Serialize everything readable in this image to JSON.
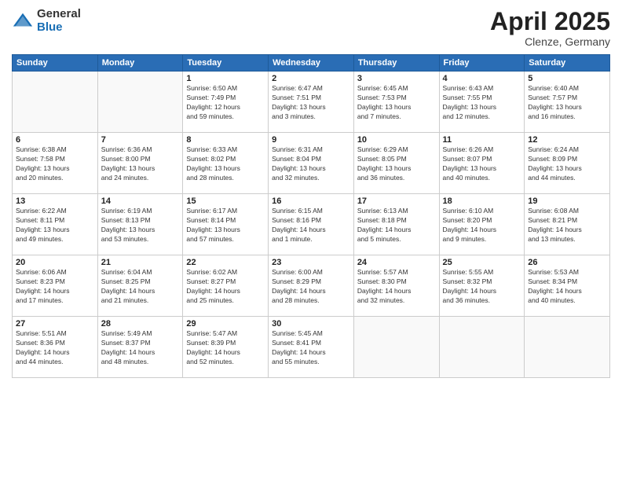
{
  "logo": {
    "general": "General",
    "blue": "Blue"
  },
  "title": {
    "month_year": "April 2025",
    "location": "Clenze, Germany"
  },
  "weekdays": [
    "Sunday",
    "Monday",
    "Tuesday",
    "Wednesday",
    "Thursday",
    "Friday",
    "Saturday"
  ],
  "weeks": [
    [
      {
        "day": "",
        "info": ""
      },
      {
        "day": "",
        "info": ""
      },
      {
        "day": "1",
        "info": "Sunrise: 6:50 AM\nSunset: 7:49 PM\nDaylight: 12 hours\nand 59 minutes."
      },
      {
        "day": "2",
        "info": "Sunrise: 6:47 AM\nSunset: 7:51 PM\nDaylight: 13 hours\nand 3 minutes."
      },
      {
        "day": "3",
        "info": "Sunrise: 6:45 AM\nSunset: 7:53 PM\nDaylight: 13 hours\nand 7 minutes."
      },
      {
        "day": "4",
        "info": "Sunrise: 6:43 AM\nSunset: 7:55 PM\nDaylight: 13 hours\nand 12 minutes."
      },
      {
        "day": "5",
        "info": "Sunrise: 6:40 AM\nSunset: 7:57 PM\nDaylight: 13 hours\nand 16 minutes."
      }
    ],
    [
      {
        "day": "6",
        "info": "Sunrise: 6:38 AM\nSunset: 7:58 PM\nDaylight: 13 hours\nand 20 minutes."
      },
      {
        "day": "7",
        "info": "Sunrise: 6:36 AM\nSunset: 8:00 PM\nDaylight: 13 hours\nand 24 minutes."
      },
      {
        "day": "8",
        "info": "Sunrise: 6:33 AM\nSunset: 8:02 PM\nDaylight: 13 hours\nand 28 minutes."
      },
      {
        "day": "9",
        "info": "Sunrise: 6:31 AM\nSunset: 8:04 PM\nDaylight: 13 hours\nand 32 minutes."
      },
      {
        "day": "10",
        "info": "Sunrise: 6:29 AM\nSunset: 8:05 PM\nDaylight: 13 hours\nand 36 minutes."
      },
      {
        "day": "11",
        "info": "Sunrise: 6:26 AM\nSunset: 8:07 PM\nDaylight: 13 hours\nand 40 minutes."
      },
      {
        "day": "12",
        "info": "Sunrise: 6:24 AM\nSunset: 8:09 PM\nDaylight: 13 hours\nand 44 minutes."
      }
    ],
    [
      {
        "day": "13",
        "info": "Sunrise: 6:22 AM\nSunset: 8:11 PM\nDaylight: 13 hours\nand 49 minutes."
      },
      {
        "day": "14",
        "info": "Sunrise: 6:19 AM\nSunset: 8:13 PM\nDaylight: 13 hours\nand 53 minutes."
      },
      {
        "day": "15",
        "info": "Sunrise: 6:17 AM\nSunset: 8:14 PM\nDaylight: 13 hours\nand 57 minutes."
      },
      {
        "day": "16",
        "info": "Sunrise: 6:15 AM\nSunset: 8:16 PM\nDaylight: 14 hours\nand 1 minute."
      },
      {
        "day": "17",
        "info": "Sunrise: 6:13 AM\nSunset: 8:18 PM\nDaylight: 14 hours\nand 5 minutes."
      },
      {
        "day": "18",
        "info": "Sunrise: 6:10 AM\nSunset: 8:20 PM\nDaylight: 14 hours\nand 9 minutes."
      },
      {
        "day": "19",
        "info": "Sunrise: 6:08 AM\nSunset: 8:21 PM\nDaylight: 14 hours\nand 13 minutes."
      }
    ],
    [
      {
        "day": "20",
        "info": "Sunrise: 6:06 AM\nSunset: 8:23 PM\nDaylight: 14 hours\nand 17 minutes."
      },
      {
        "day": "21",
        "info": "Sunrise: 6:04 AM\nSunset: 8:25 PM\nDaylight: 14 hours\nand 21 minutes."
      },
      {
        "day": "22",
        "info": "Sunrise: 6:02 AM\nSunset: 8:27 PM\nDaylight: 14 hours\nand 25 minutes."
      },
      {
        "day": "23",
        "info": "Sunrise: 6:00 AM\nSunset: 8:29 PM\nDaylight: 14 hours\nand 28 minutes."
      },
      {
        "day": "24",
        "info": "Sunrise: 5:57 AM\nSunset: 8:30 PM\nDaylight: 14 hours\nand 32 minutes."
      },
      {
        "day": "25",
        "info": "Sunrise: 5:55 AM\nSunset: 8:32 PM\nDaylight: 14 hours\nand 36 minutes."
      },
      {
        "day": "26",
        "info": "Sunrise: 5:53 AM\nSunset: 8:34 PM\nDaylight: 14 hours\nand 40 minutes."
      }
    ],
    [
      {
        "day": "27",
        "info": "Sunrise: 5:51 AM\nSunset: 8:36 PM\nDaylight: 14 hours\nand 44 minutes."
      },
      {
        "day": "28",
        "info": "Sunrise: 5:49 AM\nSunset: 8:37 PM\nDaylight: 14 hours\nand 48 minutes."
      },
      {
        "day": "29",
        "info": "Sunrise: 5:47 AM\nSunset: 8:39 PM\nDaylight: 14 hours\nand 52 minutes."
      },
      {
        "day": "30",
        "info": "Sunrise: 5:45 AM\nSunset: 8:41 PM\nDaylight: 14 hours\nand 55 minutes."
      },
      {
        "day": "",
        "info": ""
      },
      {
        "day": "",
        "info": ""
      },
      {
        "day": "",
        "info": ""
      }
    ]
  ]
}
